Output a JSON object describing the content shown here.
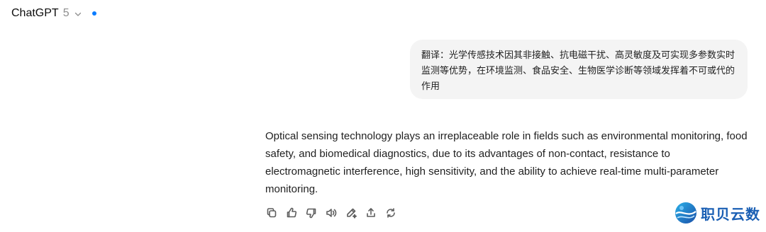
{
  "header": {
    "app_name": "ChatGPT",
    "model_version": "5",
    "status_dot_color": "#0a7cff"
  },
  "conversation": {
    "user_message": "翻译：光学传感技术因其非接触、抗电磁干扰、高灵敏度及可实现多参数实时监测等优势，在环境监测、食品安全、生物医学诊断等领域发挥着不可或代的作用",
    "assistant_message": "Optical sensing technology plays an irreplaceable role in fields such as environmental monitoring, food safety, and biomedical diagnostics, due to its advantages of non-contact, resistance to electromagnetic interference, high sensitivity, and the ability to achieve real-time multi-parameter monitoring."
  },
  "toolbar": {
    "icons": [
      "copy-icon",
      "thumbs-up-icon",
      "thumbs-down-icon",
      "speaker-icon",
      "edit-icon",
      "share-icon",
      "regenerate-icon"
    ]
  },
  "watermark": {
    "text": "职贝云数",
    "color": "#1a5fb4"
  }
}
